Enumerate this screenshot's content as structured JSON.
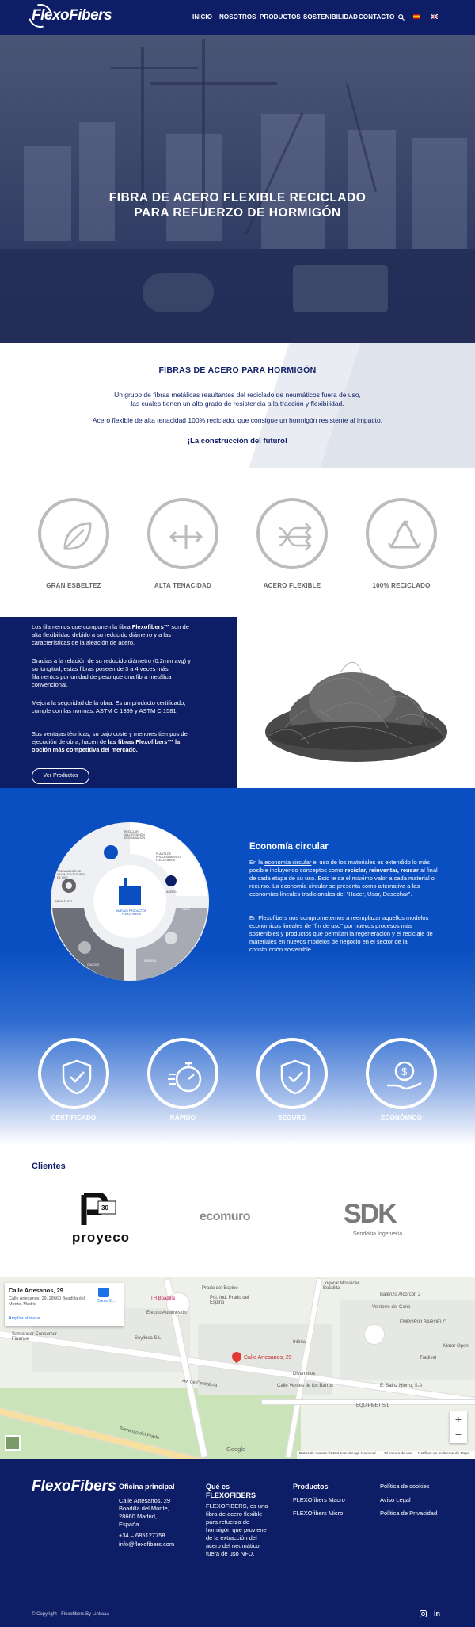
{
  "brand": {
    "name": "FlexoFibers"
  },
  "nav": {
    "items": [
      "INICIO",
      "NOSOTROS",
      "PRODUCTOS",
      "SOSTENIBILIDAD",
      "CONTACTO"
    ]
  },
  "hero": {
    "title_line1": "FIBRA DE ACERO FLEXIBLE RECICLADO",
    "title_line2": "PARA REFUERZO DE HORMIGÓN"
  },
  "intro": {
    "heading": "FIBRAS DE ACERO PARA HORMIGÓN",
    "p1_line1": "Un grupo de fibras metálicas resultantes del reciclado de neumáticos fuera de uso,",
    "p1_line2": "las cuales tienen un alto grado de resistencia a la tracción y flexibilidad.",
    "p2": "Acero flexible de alta tenacidad 100% reciclado, que consigue un hormigón resistente al impacto.",
    "tagline": "¡La construcción del futuro!"
  },
  "features": [
    "GRAN ESBELTEZ",
    "ALTA TENACIDAD",
    "ACERO FLEXIBLE",
    "100% RECICLADO"
  ],
  "about": {
    "p1_pre": "Los filamentos que componen la fibra ",
    "p1_bold": "Flexofibers™",
    "p1_post": " son de alta flexibilidad debido a su reducido diámetro y a las características de la aleación de acero.",
    "p2": "Gracias a la relación de su reducido diámetro (0.2mm avg) y su longitud, estas fibras poseen de 3 a 4 veces más filamentos por unidad de peso que una fibra metálica convencional.",
    "p3": "Mejora la seguridad de la obra. Es un producto certificado, cumple con las normas: ASTM C 1399 y ASTM C 1581.",
    "p4_pre": "Sus ventajas técnicas, su bajo coste y menores tiempos de ejecución de obra, hacen de ",
    "p4_bold": "las fibras Flexofibers™ la opción más competitiva del mercado.",
    "button": "Ver Productos"
  },
  "economy": {
    "heading": "Economía circular",
    "p1_a": "En la ",
    "p1_link": "economía circular",
    "p1_b": " el uso de los materiales es extendido lo más posible incluyendo conceptos como ",
    "p1_bold": "reciclar, reinventar, reusar",
    "p1_c": " al final de cada etapa de su uso. Esto le da el máximo valor a cada material o recurso. La economía circular se presenta como alternativa a las economías lineales tradicionales del \"Hacer, Usar, Desechar\".",
    "p2": "En Flexofibers nos comprometemos a reemplazar aquellos modelos económicos lineales de \"fin de uso\" por nuevos procesos más sostenibles y productos que permitan la regeneración y el reciclaje de materiales en nuevos modelos de negocio en el sector de la construcción sostenible.",
    "diagram_labels": [
      "RECICLAR VALORIZACIÓN DEGRADACIÓN",
      "PLANTA DE PROCESAMIENTO FLEXOFIBERS",
      "ACERO",
      "OBRA",
      "FABRICA",
      "CAUCHO",
      "NEUMÁTICO",
      "TRATAMIENTO DE NEUMÁTICOS FUERA DE USO",
      "RECOGIDA",
      "NUEVOS PRODUCTOS FLEXOFIBERS",
      "FINDE DE OBRA"
    ]
  },
  "benefits": [
    "CERTIFICADO",
    "RÁPIDO",
    "SEGURO",
    "ECONÓMICO"
  ],
  "clients": {
    "heading": "Clientes",
    "logos": [
      "proyeco",
      "ecomuro",
      "SDK"
    ],
    "proyeco_word": "proyeco",
    "proyeco_num": "30",
    "ecomuro_word": "ecomuro",
    "sdk_word": "SDK",
    "sdk_sub": "Sendekia Ingeniería"
  },
  "map": {
    "card_title": "Calle Artesanos, 29",
    "card_addr": "Calle Artesanos, 29, 28660 Boadilla del Monte, Madrid",
    "card_link": "Ampliar el mapa",
    "card_dir": "Cómo ll...",
    "pin_label": "Calle Artesanos, 29",
    "places": [
      "Prado del Espino",
      "Pol. Ind. Prado del Espino",
      "Electro Audiovisión",
      "TH Boadilla",
      "Seyllosa S.L",
      "Santander Consumer Finance",
      "Av. de Cantabria",
      "Calle Verdes de los Barros",
      "Ventorro del Cano",
      "EMPORIO BAROELO",
      "Barranco del Prado",
      "Jogaral Mosaicar Boadilla",
      "Balenzo Alcorcón 2",
      "Infinia",
      "Motor Open",
      "Tradivel",
      "E. Sainz Hierro, S.A",
      "EQUIPMET S.L",
      "Divamotos",
      "Calle de los Barros",
      "S. Ciudad",
      "Calle Valle de los Barros"
    ],
    "footer": [
      "Datos de mapas ©2021 Inst. Geogr. Nacional",
      "Términos de uso",
      "Notificar un problema de Maps"
    ],
    "google": "Google"
  },
  "footer": {
    "office_h": "Oficina principal",
    "office_l1": "Calle Artesanos, 29",
    "office_l2": "Boadilla del Monte,",
    "office_l3": "28660 Madrid,",
    "office_l4": "España",
    "phone": "+34 – 685127758",
    "email": "info@flexofibers.com",
    "what_h1": "Qué es",
    "what_h2": "FLEXOFIBERS",
    "what_p": "FLEXOFIBERS, es una fibra de acero flexible para refuerzo de hormigón que proviene de la extracción del acero del neumático fuera de uso NFU.",
    "prod_h": "Productos",
    "prod_items": [
      "FLEXOfibers Macro",
      "FLEXOfibers Micro"
    ],
    "legal_items": [
      "Política de cookies",
      "Aviso Legal",
      "Política de Privacidad"
    ],
    "copyright": "© Copyright - Flexofibers By Linkaaa"
  },
  "colors": {
    "navy": "#0e1e66",
    "blue": "#0a4fc1",
    "grey": "#bcbcbc"
  }
}
